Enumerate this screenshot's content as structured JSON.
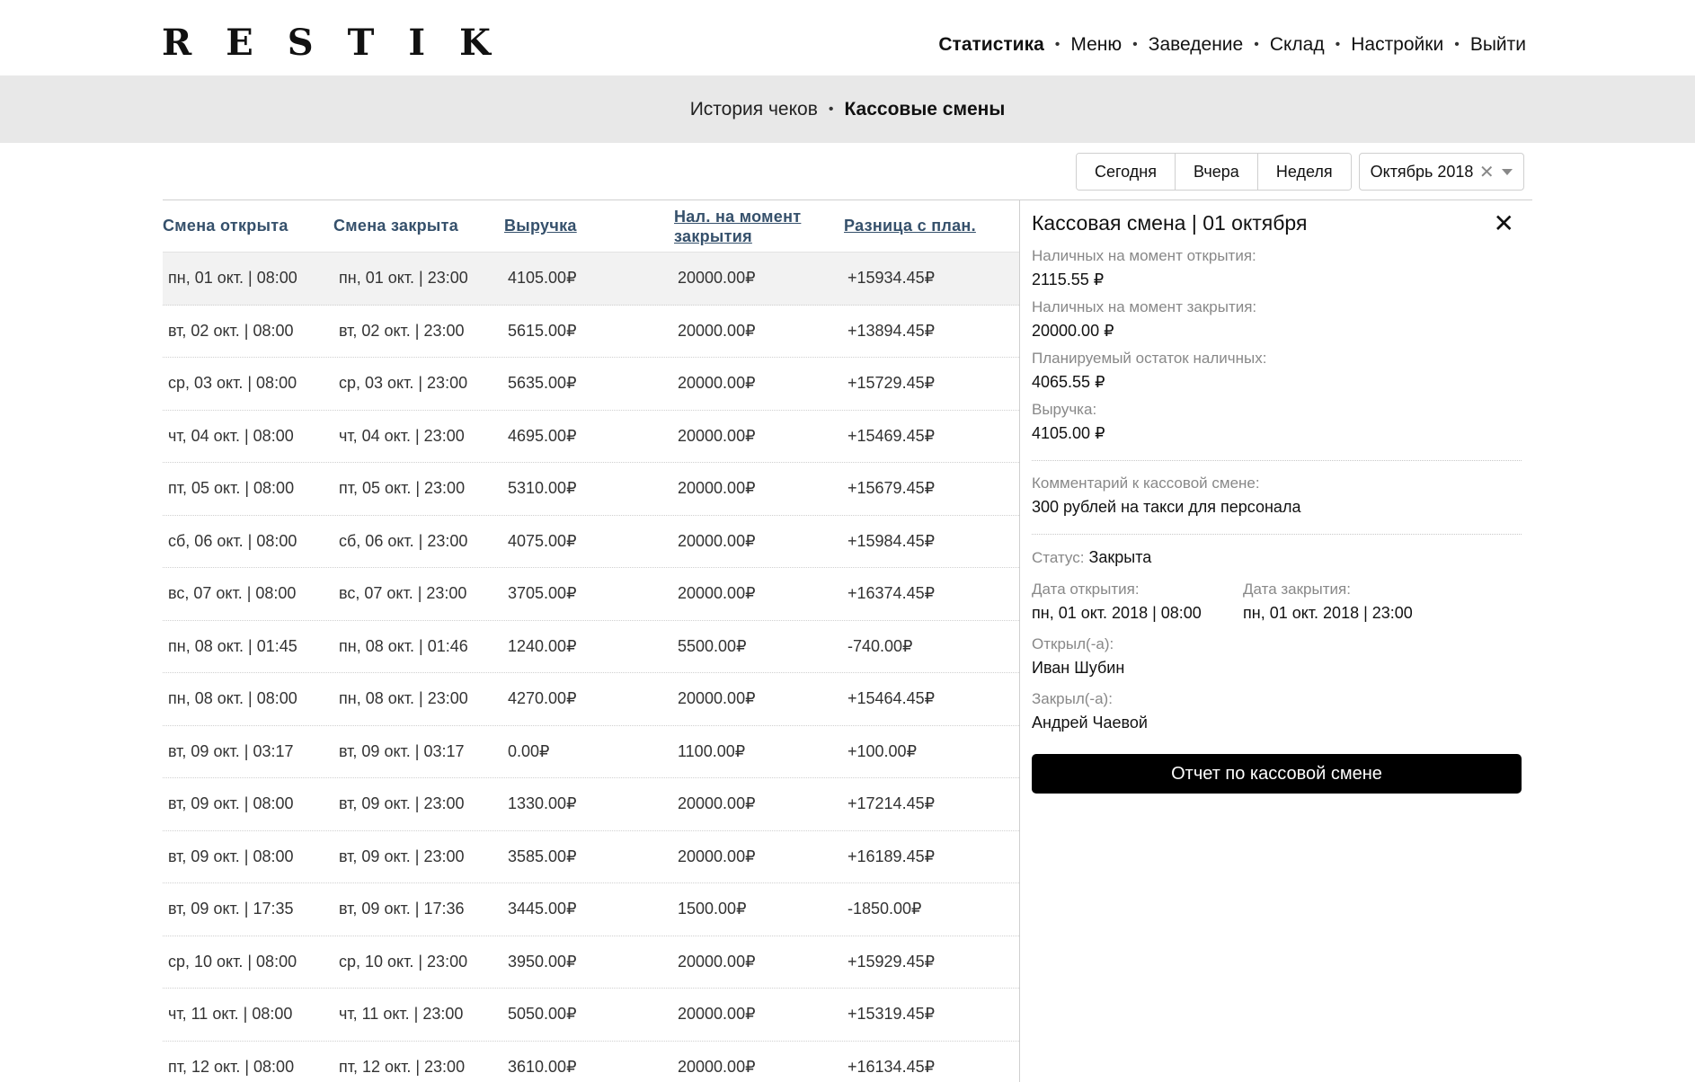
{
  "brand": {
    "logo": "RESTIK"
  },
  "topnav": [
    {
      "label": "Статистика",
      "active": true
    },
    {
      "label": "Меню",
      "active": false
    },
    {
      "label": "Заведение",
      "active": false
    },
    {
      "label": "Склад",
      "active": false
    },
    {
      "label": "Настройки",
      "active": false
    },
    {
      "label": "Выйти",
      "active": false
    }
  ],
  "subnav": [
    {
      "label": "История чеков",
      "active": false
    },
    {
      "label": "Кассовые смены",
      "active": true
    }
  ],
  "filters": {
    "segments": [
      "Сегодня",
      "Вчера",
      "Неделя"
    ],
    "month": "Октябрь 2018"
  },
  "table": {
    "headers": {
      "opened": "Смена открыта",
      "closed": "Смена закрыта",
      "revenue": "Выручка",
      "cash_close": "Нал. на момент закрытия",
      "diff": "Разница с план."
    },
    "rows": [
      [
        "пн, 01 окт. | 08:00",
        "пн, 01 окт. | 23:00",
        "4105.00₽",
        "20000.00₽",
        "+15934.45₽"
      ],
      [
        "вт, 02 окт. | 08:00",
        "вт, 02 окт. | 23:00",
        "5615.00₽",
        "20000.00₽",
        "+13894.45₽"
      ],
      [
        "ср, 03 окт. | 08:00",
        "ср, 03 окт. | 23:00",
        "5635.00₽",
        "20000.00₽",
        "+15729.45₽"
      ],
      [
        "чт, 04 окт. | 08:00",
        "чт, 04 окт. | 23:00",
        "4695.00₽",
        "20000.00₽",
        "+15469.45₽"
      ],
      [
        "пт, 05 окт. | 08:00",
        "пт, 05 окт. | 23:00",
        "5310.00₽",
        "20000.00₽",
        "+15679.45₽"
      ],
      [
        "сб, 06 окт. | 08:00",
        "сб, 06 окт. | 23:00",
        "4075.00₽",
        "20000.00₽",
        "+15984.45₽"
      ],
      [
        "вс, 07 окт. | 08:00",
        "вс, 07 окт. | 23:00",
        "3705.00₽",
        "20000.00₽",
        "+16374.45₽"
      ],
      [
        "пн, 08 окт. | 01:45",
        "пн, 08 окт. | 01:46",
        "1240.00₽",
        "5500.00₽",
        "-740.00₽"
      ],
      [
        "пн, 08 окт. | 08:00",
        "пн, 08 окт. | 23:00",
        "4270.00₽",
        "20000.00₽",
        "+15464.45₽"
      ],
      [
        "вт, 09 окт. | 03:17",
        "вт, 09 окт. | 03:17",
        "0.00₽",
        "1100.00₽",
        "+100.00₽"
      ],
      [
        "вт, 09 окт. | 08:00",
        "вт, 09 окт. | 23:00",
        "1330.00₽",
        "20000.00₽",
        "+17214.45₽"
      ],
      [
        "вт, 09 окт. | 08:00",
        "вт, 09 окт. | 23:00",
        "3585.00₽",
        "20000.00₽",
        "+16189.45₽"
      ],
      [
        "вт, 09 окт. | 17:35",
        "вт, 09 окт. | 17:36",
        "3445.00₽",
        "1500.00₽",
        "-1850.00₽"
      ],
      [
        "ср, 10 окт. | 08:00",
        "ср, 10 окт. | 23:00",
        "3950.00₽",
        "20000.00₽",
        "+15929.45₽"
      ],
      [
        "чт, 11 окт. | 08:00",
        "чт, 11 окт. | 23:00",
        "5050.00₽",
        "20000.00₽",
        "+15319.45₽"
      ],
      [
        "пт, 12 окт. | 08:00",
        "пт, 12 окт. | 23:00",
        "3610.00₽",
        "20000.00₽",
        "+16134.45₽"
      ]
    ]
  },
  "detail": {
    "title": "Кассовая смена | 01 октября",
    "cash_open_label": "Наличных на момент открытия:",
    "cash_open": "2115.55 ₽",
    "cash_close_label": "Наличных на момент закрытия:",
    "cash_close": "20000.00 ₽",
    "planned_label": "Планируемый остаток наличных:",
    "planned": "4065.55 ₽",
    "revenue_label": "Выручка:",
    "revenue": "4105.00 ₽",
    "comment_label": "Комментарий к кассовой смене:",
    "comment": "300 рублей на такси для персонала",
    "status_label": "Статус:",
    "status": "Закрыта",
    "open_date_label": "Дата открытия:",
    "open_date": "пн, 01 окт. 2018 | 08:00",
    "close_date_label": "Дата закрытия:",
    "close_date": "пн, 01 окт. 2018 | 23:00",
    "opened_by_label": "Открыл(-а):",
    "opened_by": "Иван Шубин",
    "closed_by_label": "Закрыл(-а):",
    "closed_by": "Андрей Чаевой",
    "report_button": "Отчет по кассовой смене"
  }
}
